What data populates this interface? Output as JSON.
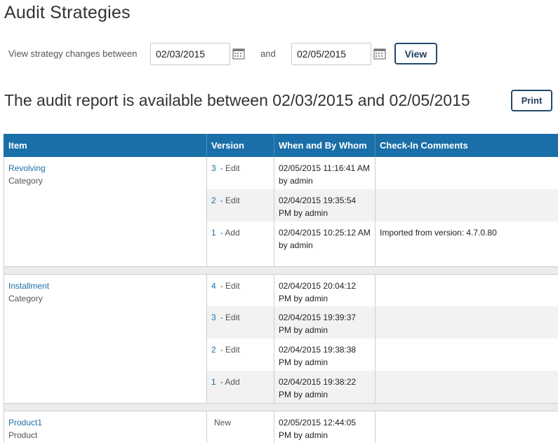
{
  "page": {
    "title": "Audit Strategies"
  },
  "filter": {
    "label": "View strategy changes between",
    "from_date": "02/03/2015",
    "and_label": "and",
    "to_date": "02/05/2015",
    "view_label": "View",
    "calendar_icon": "calendar-icon"
  },
  "report": {
    "heading": "The audit report is available between 02/03/2015 and 02/05/2015",
    "print_label": "Print"
  },
  "table": {
    "headers": [
      "Item",
      "Version",
      "When and By Whom",
      "Check-In Comments"
    ],
    "header_color": "#1a6fa8",
    "link_color": "#1a6fa8",
    "groups": [
      {
        "item": "Revolving",
        "type": "Category",
        "rows": [
          {
            "version": "3",
            "action": "- Edit",
            "when": "02/05/2015 11:16:41 AM by admin",
            "comment": ""
          },
          {
            "version": "2",
            "action": "- Edit",
            "when": "02/04/2015 19:35:54 PM by admin",
            "comment": ""
          },
          {
            "version": "1",
            "action": "- Add",
            "when": "02/04/2015 10:25:12 AM by admin",
            "comment": "Imported from version: 4.7.0.80"
          }
        ]
      },
      {
        "item": "Installment",
        "type": "Category",
        "rows": [
          {
            "version": "4",
            "action": "- Edit",
            "when": "02/04/2015 20:04:12 PM by admin",
            "comment": ""
          },
          {
            "version": "3",
            "action": "- Edit",
            "when": "02/04/2015 19:39:37 PM by admin",
            "comment": ""
          },
          {
            "version": "2",
            "action": "- Edit",
            "when": "02/04/2015 19:38:38 PM by admin",
            "comment": ""
          },
          {
            "version": "1",
            "action": "- Add",
            "when": "02/04/2015 19:38:22 PM by admin",
            "comment": ""
          }
        ]
      },
      {
        "item": "Product1",
        "type": "Product",
        "rows": [
          {
            "version": "",
            "action": "New",
            "when": "02/05/2015 12:44:05 PM by admin",
            "comment": ""
          }
        ]
      }
    ]
  }
}
